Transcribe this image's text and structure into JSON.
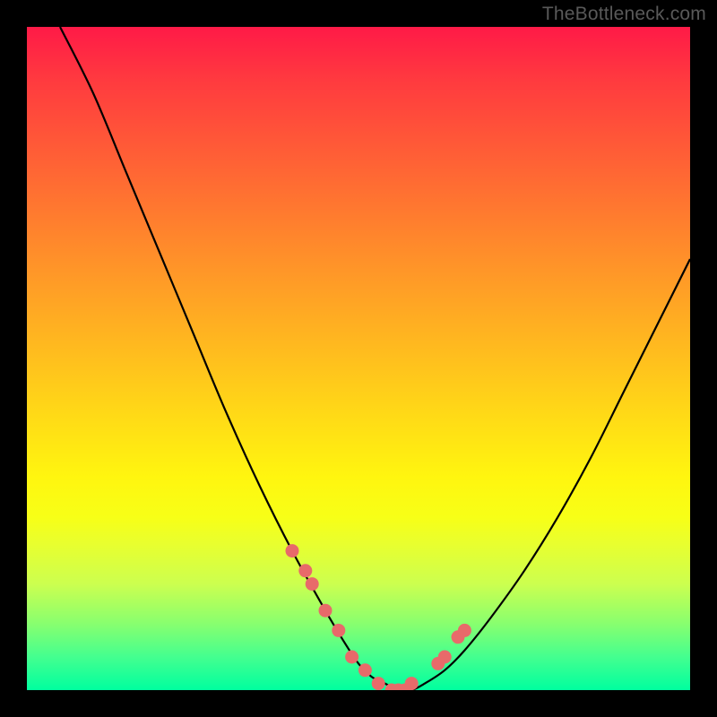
{
  "watermark": "TheBottleneck.com",
  "colors": {
    "frame": "#000000",
    "gradient_top": "#ff1a47",
    "gradient_bottom": "#00ff9f",
    "curve": "#000000",
    "dots": "#e86a6a"
  },
  "chart_data": {
    "type": "line",
    "title": "",
    "xlabel": "",
    "ylabel": "",
    "xlim": [
      0,
      100
    ],
    "ylim": [
      0,
      100
    ],
    "grid": false,
    "series": [
      {
        "name": "bottleneck-curve",
        "x": [
          5,
          10,
          15,
          20,
          25,
          30,
          35,
          40,
          45,
          48,
          50,
          52,
          54,
          56,
          58,
          60,
          63,
          66,
          70,
          75,
          80,
          85,
          90,
          95,
          100
        ],
        "values": [
          100,
          90,
          78,
          66,
          54,
          42,
          31,
          21,
          12,
          7,
          4,
          2,
          1,
          0,
          0,
          1,
          3,
          6,
          11,
          18,
          26,
          35,
          45,
          55,
          65
        ]
      }
    ],
    "highlight_points": {
      "name": "highlighted-dots",
      "x": [
        40,
        42,
        43,
        45,
        47,
        49,
        51,
        53,
        55,
        56,
        57,
        58,
        62,
        63,
        65,
        66
      ],
      "values": [
        21,
        18,
        16,
        12,
        9,
        5,
        3,
        1,
        0,
        0,
        0,
        1,
        4,
        5,
        8,
        9
      ]
    }
  }
}
